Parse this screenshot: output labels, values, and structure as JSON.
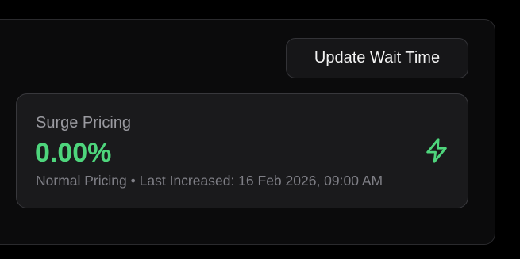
{
  "toolbar": {
    "update_wait_time_label": "Update Wait Time"
  },
  "surge_card": {
    "title": "Surge Pricing",
    "value": "0.00%",
    "status": "Normal Pricing",
    "separator": "•",
    "last_increased_label": "Last Increased:",
    "last_increased_value": "16 Feb 2026, 09:00 AM",
    "icon": "lightning-bolt-icon"
  },
  "colors": {
    "background": "#000000",
    "panel": "#0b0b0c",
    "card": "#1a1a1c",
    "accent_green": "#4ed57c",
    "muted_text": "#9a9aa0"
  }
}
